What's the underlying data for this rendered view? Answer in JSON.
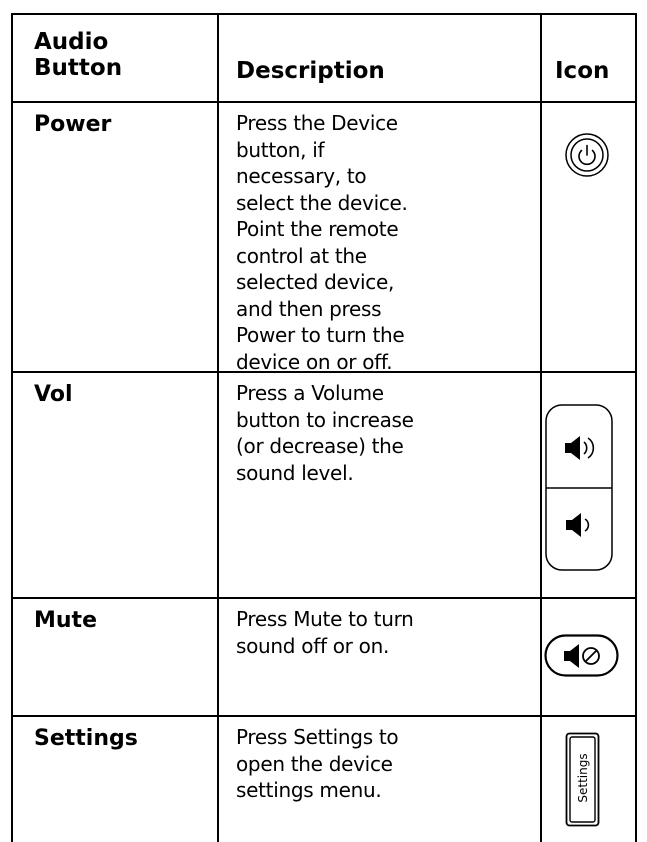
{
  "table": {
    "headers": {
      "button": "Audio\nButton",
      "description": "Description",
      "icon": "Icon"
    },
    "rows": [
      {
        "name": "Power",
        "description": "Press the Device button, if necessary, to select the device. Point the remote control at the selected device, and then press Power to turn the device on or off.",
        "icon": "power-button-icon"
      },
      {
        "name": "Vol",
        "description": "Press a Volume button to increase (or decrease) the sound level.",
        "icon": "volume-rocker-icon"
      },
      {
        "name": "Mute",
        "description": "Press Mute to turn sound off or on.",
        "icon": "mute-button-icon"
      },
      {
        "name": "Settings",
        "description": "Press Settings to open the device settings menu.",
        "icon": "settings-button-icon",
        "icon_label": "Settings"
      }
    ]
  }
}
